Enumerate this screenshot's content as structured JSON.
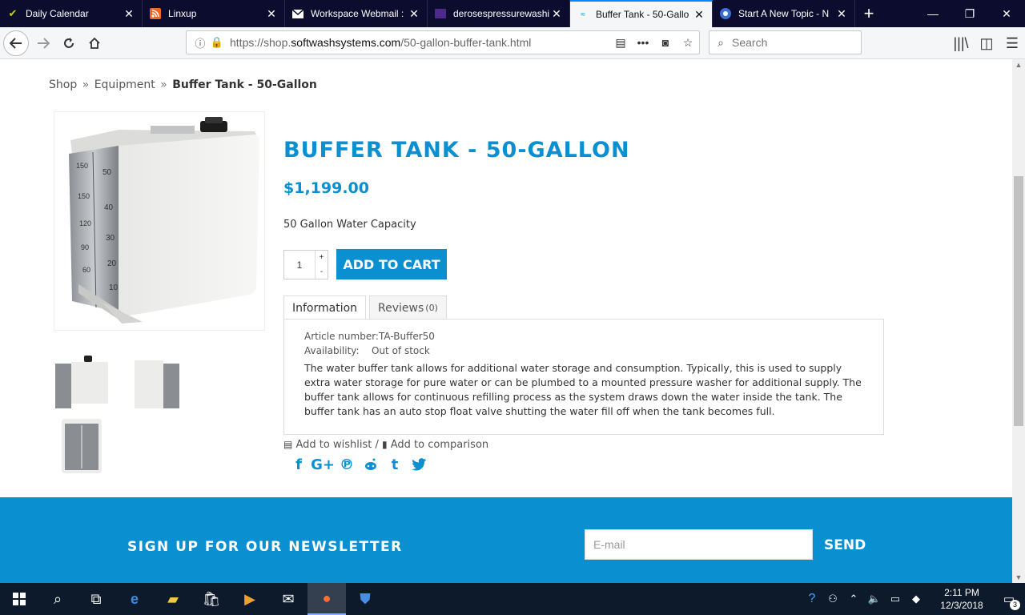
{
  "browser": {
    "tabs": [
      {
        "label": "Daily Calendar",
        "icon": "check-icon",
        "active": false
      },
      {
        "label": "Linxup",
        "icon": "rss-icon",
        "active": false
      },
      {
        "label": "Workspace Webmail :",
        "icon": "mail-icon",
        "active": false
      },
      {
        "label": "derosespressurewashi",
        "icon": "site-icon",
        "active": false
      },
      {
        "label": "Buffer Tank - 50-Gallo",
        "icon": "softwash-icon",
        "active": true
      },
      {
        "label": "Start A New Topic - N",
        "icon": "forum-icon",
        "active": false
      }
    ],
    "url_prefix": "https://shop.",
    "url_domain": "softwashsystems.com",
    "url_path": "/50-gallon-buffer-tank.html",
    "search_placeholder": "Search",
    "accent": "#0a84ff"
  },
  "page": {
    "breadcrumb": {
      "items": [
        "Shop",
        "Equipment"
      ],
      "separator": "»",
      "current": "Buffer Tank - 50-Gallon"
    },
    "product": {
      "title": "BUFFER TANK - 50-GALLON",
      "price": "$1,199.00",
      "short_description": "50 Gallon Water Capacity",
      "quantity": "1",
      "qty_plus": "+",
      "qty_minus": "-",
      "add_to_cart": "ADD TO CART",
      "tabs": {
        "information": "Information",
        "reviews": "Reviews",
        "reviews_count": "(0)"
      },
      "specs": {
        "article_label": "Article number:",
        "article_value": "TA-Buffer50",
        "availability_label": "Availability:",
        "availability_value": "Out of stock"
      },
      "description": "The water buffer tank allows for additional water storage and consumption. Typically, this is used to supply extra water storage for pure water or can be plumbed to a mounted pressure washer for additional supply. The buffer tank allows for continuous refilling process as the system draws down the water inside the tank. The buffer tank has an auto stop float valve shutting the water fill off when the tank becomes full.",
      "wishlist": "Add to wishlist",
      "separator": "/",
      "comparison": "Add to comparison",
      "tank_markings": {
        "left": [
          "150",
          "150",
          "120",
          "90",
          "60"
        ],
        "right": [
          "50",
          "40",
          "30",
          "20",
          "10"
        ]
      }
    },
    "social": [
      "f",
      "G+",
      "P",
      "reddit",
      "t",
      "twitter"
    ],
    "newsletter": {
      "title": "SIGN UP FOR OUR NEWSLETTER",
      "placeholder": "E-mail",
      "send": "SEND"
    },
    "brand_color": "#0a8fd0"
  },
  "taskbar": {
    "time": "2:11 PM",
    "date": "12/3/2018",
    "notifications": "3"
  }
}
